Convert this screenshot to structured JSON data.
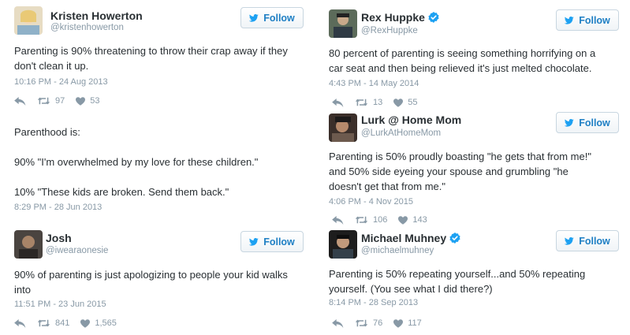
{
  "follow_label": "Follow",
  "tweets": [
    {
      "name": "Kristen Howerton",
      "handle": "@kristenhowerton",
      "verified": false,
      "text": [
        "Parenting is 90% threatening to throw their crap away if they",
        "don't clean it up."
      ],
      "timestamp": "10:16 PM - 24 Aug 2013",
      "retweets": "97",
      "likes": "53"
    },
    {
      "name": "Rex Huppke",
      "handle": "@RexHuppke",
      "verified": true,
      "text": [
        "80 percent of parenting is seeing something horrifying on a",
        "car seat and then being relieved it's just melted chocolate."
      ],
      "timestamp": "4:43 PM - 14 May 2014",
      "retweets": "13",
      "likes": "55"
    },
    {
      "text": [
        "Parenthood is:",
        "",
        "90% \"I'm overwhelmed by my love for these children.\"",
        "",
        "10% \"These kids are broken. Send them back.\""
      ],
      "timestamp": "8:29 PM - 28 Jun 2013"
    },
    {
      "name": "Lurk @ Home Mom",
      "handle": "@LurkAtHomeMom",
      "verified": false,
      "text": [
        "Parenting is 50% proudly boasting \"he gets that from me!\"",
        "and 50% side eyeing your spouse and grumbling \"he",
        "doesn't get that from me.\""
      ],
      "timestamp": "4:06 PM - 4 Nov 2015",
      "retweets": "106",
      "likes": "143"
    },
    {
      "name": "Josh",
      "handle": "@iwearaonesie",
      "verified": false,
      "text": [
        "90% of parenting is just apologizing to people your kid walks",
        "into"
      ],
      "timestamp": "11:51 PM - 23 Jun 2015",
      "retweets": "841",
      "likes": "1,565"
    },
    {
      "name": "Michael Muhney",
      "handle": "@michaelmuhney",
      "verified": true,
      "text": [
        "Parenting is 50% repeating yourself...and 50% repeating",
        "yourself. (You see what I did there?)"
      ],
      "timestamp": "8:14 PM - 28 Sep 2013",
      "retweets": "76",
      "likes": "117"
    }
  ],
  "colors": {
    "text": "#292f33",
    "muted": "#8899a6",
    "twitter_blue": "#1da1f2",
    "follow_text": "#1e7fc4",
    "verified": "#1da1f2"
  },
  "icons": [
    "reply-icon",
    "retweet-icon",
    "like-icon",
    "twitter-bird-icon",
    "verified-badge-icon"
  ]
}
